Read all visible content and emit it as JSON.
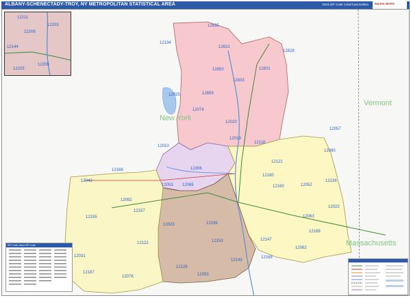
{
  "header": {
    "title": "ALBANY-SCHENECTADY-TROY, NY METROPOLITAN STATISTICAL AREA",
    "subtitle": "2023 ZIP Code Color/Cast Edition"
  },
  "logo": {
    "text": "Market MAPS"
  },
  "state_labels": [
    {
      "label": "Vermont"
    },
    {
      "label": "New York"
    },
    {
      "label": "Massachusetts"
    }
  ],
  "zips": [
    "12835",
    "12822",
    "12828",
    "12134",
    "12850",
    "12831",
    "12833",
    "12025",
    "12859",
    "12074",
    "12020",
    "12010",
    "12118",
    "12057",
    "12090",
    "12019",
    "12121",
    "12166",
    "12306",
    "12053",
    "12065",
    "12180",
    "12052",
    "12138",
    "12043",
    "12160",
    "12092",
    "12157",
    "12022",
    "12155",
    "12023",
    "12196",
    "12153",
    "12063",
    "12169",
    "12122",
    "12147",
    "12062",
    "12143",
    "12168",
    "12129",
    "12187",
    "12076",
    "12083",
    "12031",
    "12211",
    "12206",
    "12203",
    "12144",
    "12209",
    "12205"
  ],
  "legend": {
    "title": "ZIP Code Listed ZIP Code"
  },
  "key": {
    "title": "Legend"
  }
}
